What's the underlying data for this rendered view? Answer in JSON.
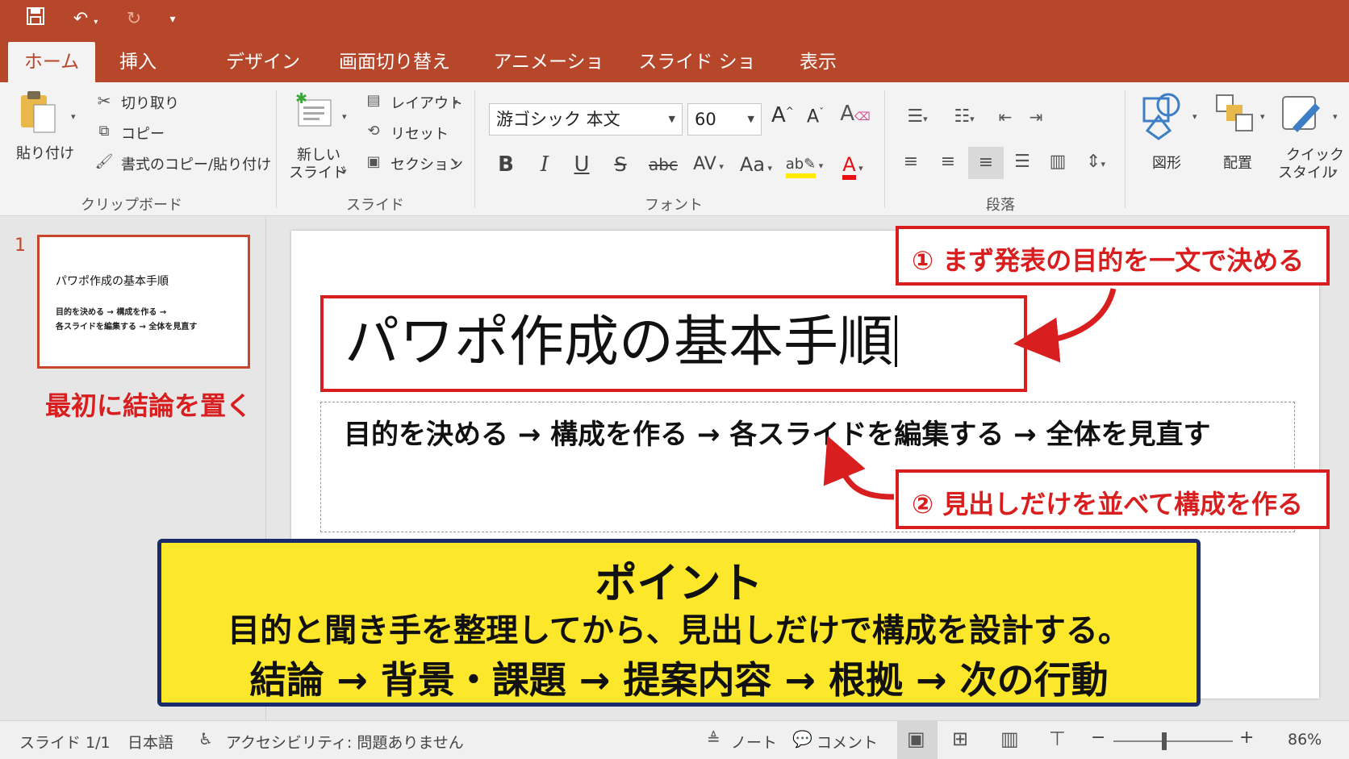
{
  "colors": {
    "accent": "#b7472a",
    "callout_red": "#d81e1e",
    "point_yellow": "#fde72b",
    "point_border": "#1a2a6c"
  },
  "tabs": [
    "ホーム",
    "挿入",
    "デザイン",
    "画面切り替え",
    "アニメーション",
    "スライド ショー",
    "表示"
  ],
  "ribbon": {
    "clipboard": {
      "paste": "貼り付け",
      "cut": "切り取り",
      "copy": "コピー",
      "format_painter": "書式のコピー/貼り付け",
      "group": "クリップボード"
    },
    "slides": {
      "new_slide_1": "新しい",
      "new_slide_2": "スライド",
      "layout": "レイアウト",
      "reset": "リセット",
      "section": "セクション",
      "group": "スライド"
    },
    "font": {
      "name": "游ゴシック 本文",
      "size": "60",
      "bold": "B",
      "italic": "I",
      "underline": "U",
      "shadow": "S",
      "strike": "abc",
      "spacing": "AV",
      "case": "Aa",
      "color": "A",
      "grow": "A",
      "shrink": "A",
      "group": "フォント"
    },
    "paragraph": {
      "group": "段落"
    },
    "drawing": {
      "shapes": "図形",
      "arrange": "配置",
      "quick_style_1": "クイック",
      "quick_style_2": "スタイル"
    }
  },
  "thumbnail": {
    "number": "1",
    "title": "パワポ作成の基本手順",
    "line1": "目的を決める → 構成を作る →",
    "line2": "各スライドを編集する → 全体を見直す",
    "caption": "最初に結論を置く"
  },
  "slide": {
    "title": "パワポ作成の基本手順",
    "body": "目的を決める → 構成を作る → 各スライドを編集する → 全体を見直す"
  },
  "callouts": {
    "one": "① まず発表の目的を一文で決める",
    "two": "② 見出しだけを並べて構成を作る"
  },
  "point": {
    "heading": "ポイント",
    "line1": "目的と聞き手を整理してから、見出しだけで構成を設計する。",
    "line2": "結論 → 背景・課題 → 提案内容 → 根拠 → 次の行動"
  },
  "status": {
    "slide": "スライド 1/1",
    "language": "日本語",
    "accessibility": "アクセシビリティ: 問題ありません",
    "notes": "ノート",
    "comments": "コメント",
    "zoom_minus": "−",
    "zoom_plus": "+",
    "zoom": "86%"
  }
}
